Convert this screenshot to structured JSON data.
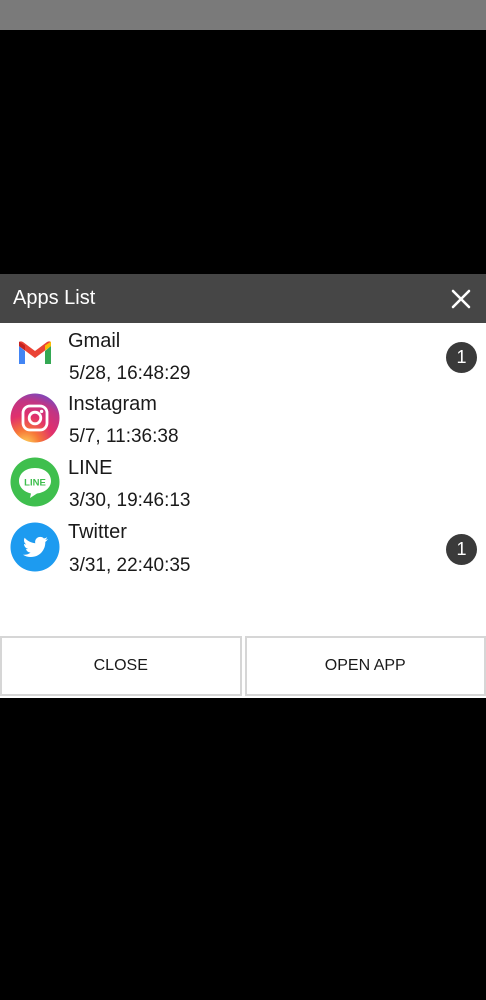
{
  "dialog": {
    "title": "Apps List",
    "close_icon": "close-icon"
  },
  "apps": [
    {
      "name": "Gmail",
      "time": "5/28, 16:48:29",
      "badge": "1",
      "icon": "gmail-icon"
    },
    {
      "name": "Instagram",
      "time": "5/7, 11:36:38",
      "badge": "",
      "icon": "instagram-icon"
    },
    {
      "name": "LINE",
      "time": "3/30, 19:46:13",
      "badge": "",
      "icon": "line-icon",
      "icon_label": "LINE"
    },
    {
      "name": "Twitter",
      "time": "3/31, 22:40:35",
      "badge": "1",
      "icon": "twitter-icon"
    }
  ],
  "buttons": {
    "close": "CLOSE",
    "open_app": "OPEN APP"
  },
  "colors": {
    "header_bg": "#464646",
    "badge_bg": "#3a3a3a",
    "line_green": "#3fbf4e",
    "twitter_blue": "#1d9bf0"
  }
}
